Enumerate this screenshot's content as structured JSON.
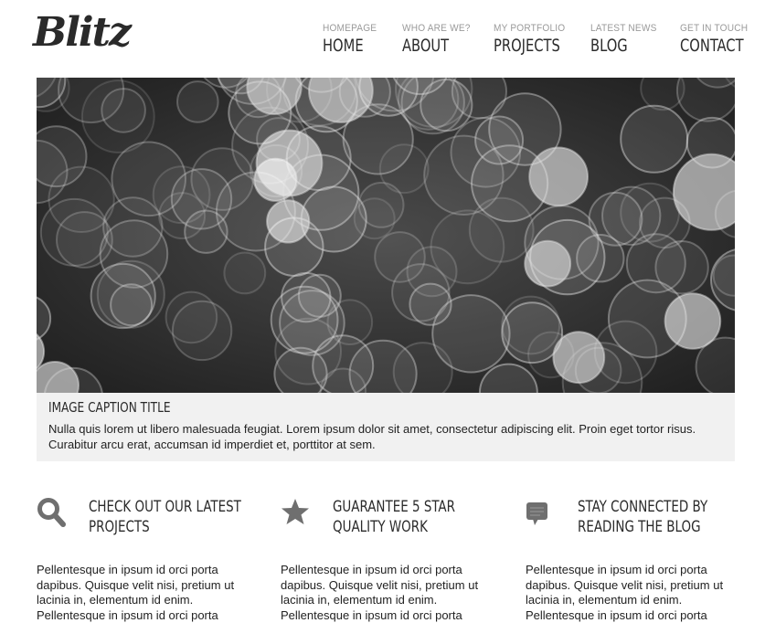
{
  "logo": "Blitz",
  "nav": [
    {
      "sub": "HOMEPAGE",
      "main": "HOME"
    },
    {
      "sub": "WHO ARE WE?",
      "main": "ABOUT"
    },
    {
      "sub": "MY PORTFOLIO",
      "main": "PROJECTS"
    },
    {
      "sub": "LATEST NEWS",
      "main": "BLOG"
    },
    {
      "sub": "GET IN TOUCH",
      "main": "CONTACT"
    }
  ],
  "hero": {
    "caption_title": "IMAGE CAPTION TITLE",
    "caption_text": "Nulla quis lorem ut libero malesuada feugiat. Lorem ipsum dolor sit amet, consectetur adipiscing elit. Proin eget tortor risus. Curabitur arcu erat, accumsan id imperdiet et, porttitor at sem."
  },
  "features": [
    {
      "icon": "search-icon",
      "title": "CHECK OUT OUR LATEST PROJECTS",
      "text": "Pellentesque in ipsum id orci porta dapibus. Quisque velit nisi, pretium ut lacinia in, elementum id enim. Pellentesque in ipsum id orci porta"
    },
    {
      "icon": "star-icon",
      "title": "GUARANTEE 5 STAR QUALITY WORK",
      "text": "Pellentesque in ipsum id orci porta dapibus. Quisque velit nisi, pretium ut lacinia in, elementum id enim. Pellentesque in ipsum id orci porta"
    },
    {
      "icon": "chat-bubble-icon",
      "title": "STAY CONNECTED BY READING THE BLOG",
      "text": "Pellentesque in ipsum id orci porta dapibus. Quisque velit nisi, pretium ut lacinia in, elementum id enim. Pellentesque in ipsum id orci porta"
    }
  ],
  "colors": {
    "icon": "#6f6f6f",
    "caption_bg": "#f1f1f1"
  }
}
